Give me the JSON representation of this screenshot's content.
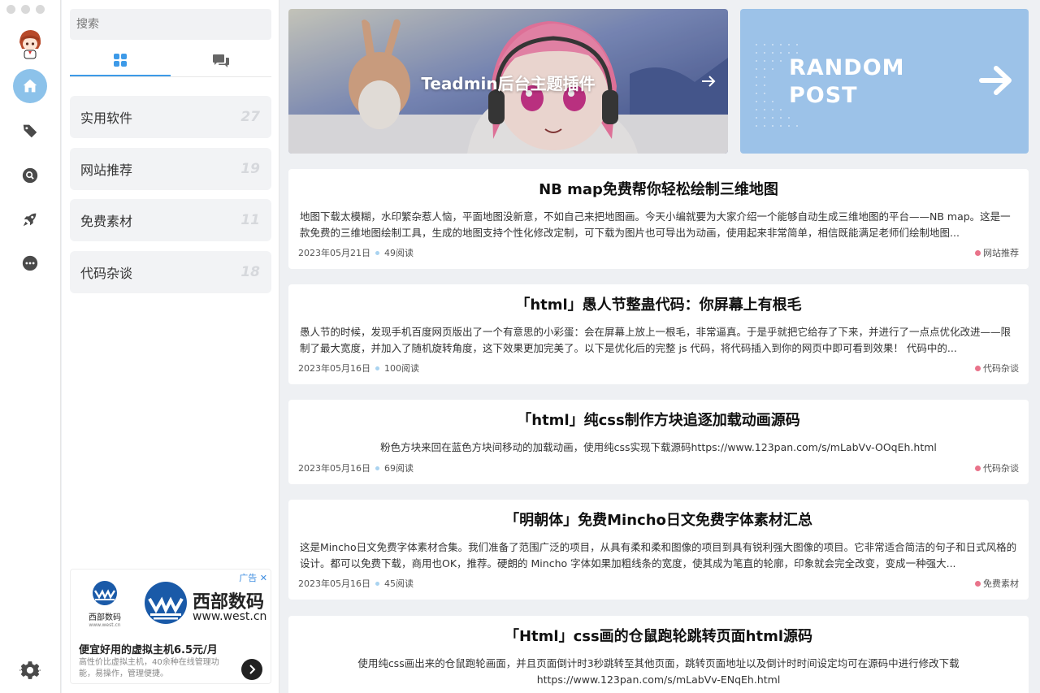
{
  "sidebar": {
    "search_placeholder": "搜索",
    "categories": [
      {
        "name": "实用软件",
        "count": "27"
      },
      {
        "name": "网站推荐",
        "count": "19"
      },
      {
        "name": "免费素材",
        "count": "11"
      },
      {
        "name": "代码杂谈",
        "count": "18"
      }
    ],
    "ad": {
      "tag": "广告",
      "logo_small_name": "西部数码",
      "logo_small_url": "www.west.cn",
      "brand_name": "西部数码",
      "brand_url": "www.west.cn",
      "title": "便宜好用的虚拟主机6.5元/月",
      "description": "高性价比虚拟主机，40余种在线管理功能，易操作，管理便捷。"
    }
  },
  "rail": {
    "icons": [
      "avatar",
      "home-icon",
      "tag-icon",
      "search-icon",
      "rocket-icon",
      "more-icon"
    ],
    "active": "home-icon",
    "accent": "#8cc2ea"
  },
  "banner": {
    "title": "Teadmin后台主题插件"
  },
  "random": {
    "line1": "RANDOM",
    "line2": "POST",
    "color": "#9cc2e8"
  },
  "posts": [
    {
      "title": "NB map免费帮你轻松绘制三维地图",
      "excerpt": "地图下载太模糊，水印繁杂惹人恼，平面地图没新意，不如自己来把地图画。今天小编就要为大家介绍一个能够自动生成三维地图的平台——NB map。这是一款免费的三维地图绘制工具，生成的地图支持个性化修改定制，可下载为图片也可导出为动画，使用起来非常简单，相信既能满足老师们绘制地图...",
      "date": "2023年05月21日",
      "views": "49阅读",
      "category": "网站推荐"
    },
    {
      "title": "「html」愚人节整蛊代码：你屏幕上有根毛",
      "excerpt": "愚人节的时候，发现手机百度网页版出了一个有意思的小彩蛋：会在屏幕上放上一根毛，非常逼真。于是乎就把它给存了下来，并进行了一点点优化改进——限制了最大宽度，并加入了随机旋转角度，这下效果更加完美了。以下是优化后的完整 js 代码，将代码插入到你的网页中即可看到效果！ 代码中的...",
      "date": "2023年05月16日",
      "views": "100阅读",
      "category": "代码杂谈"
    },
    {
      "title": "「html」纯css制作方块追逐加载动画源码",
      "excerpt": "粉色方块来回在蓝色方块间移动的加载动画，使用纯css实现下载源码https://www.123pan.com/s/mLabVv-OOqEh.html",
      "date": "2023年05月16日",
      "views": "69阅读",
      "category": "代码杂谈"
    },
    {
      "title": "「明朝体」免费Mincho日文免费字体素材汇总",
      "excerpt": "这是Mincho日文免费字体素材合集。我们准备了范围广泛的项目，从具有柔和柔和图像的项目到具有锐利强大图像的项目。它非常适合简洁的句子和日式风格的设计。都可以免费下载，商用也OK，推荐。硬朗的 Mincho 字体如果加粗线条的宽度，使其成为笔直的轮廓，印象就会完全改变，变成一种强大...",
      "date": "2023年05月16日",
      "views": "45阅读",
      "category": "免费素材"
    },
    {
      "title": "「Html」css画的仓鼠跑轮跳转页面html源码",
      "excerpt": "使用纯css画出来的仓鼠跑轮画面，并且页面倒计时3秒跳转至其他页面，跳转页面地址以及倒计时时间设定均可在源码中进行修改下载https://www.123pan.com/s/mLabVv-ENqEh.html"
    }
  ]
}
